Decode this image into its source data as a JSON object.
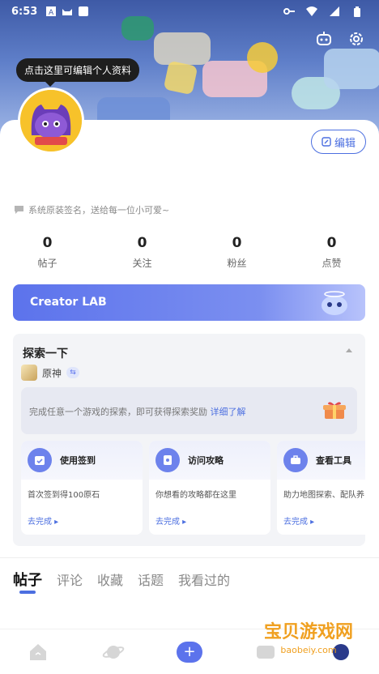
{
  "status_bar": {
    "time": "6:53"
  },
  "profile": {
    "tooltip": "点击这里可编辑个人资料",
    "edit_label": "编辑",
    "signature": "系统原装签名，送给每一位小可爱~"
  },
  "stats": [
    {
      "value": "0",
      "label": "帖子"
    },
    {
      "value": "0",
      "label": "关注"
    },
    {
      "value": "0",
      "label": "粉丝"
    },
    {
      "value": "0",
      "label": "点赞"
    }
  ],
  "creator_banner": {
    "title": "Creator LAB"
  },
  "explore": {
    "title": "探索一下",
    "game_name": "原神",
    "tip_text": "完成任意一个游戏的探索，即可获得探索奖励",
    "tip_link": "详细了解",
    "tasks": [
      {
        "name": "使用签到",
        "desc": "首次签到得100原石",
        "action": "去完成"
      },
      {
        "name": "访问攻略",
        "desc": "你想看的攻略都在这里",
        "action": "去完成"
      },
      {
        "name": "查看工具",
        "desc": "助力地图探索、配队养",
        "action": "去完成"
      }
    ]
  },
  "tabs": [
    "帖子",
    "评论",
    "收藏",
    "话题",
    "我看过的"
  ],
  "watermark": {
    "line1": "宝贝游戏网",
    "line2": "baobeiy.com"
  },
  "colors": {
    "accent": "#4c6fe0",
    "creator": "#5c73ec"
  }
}
